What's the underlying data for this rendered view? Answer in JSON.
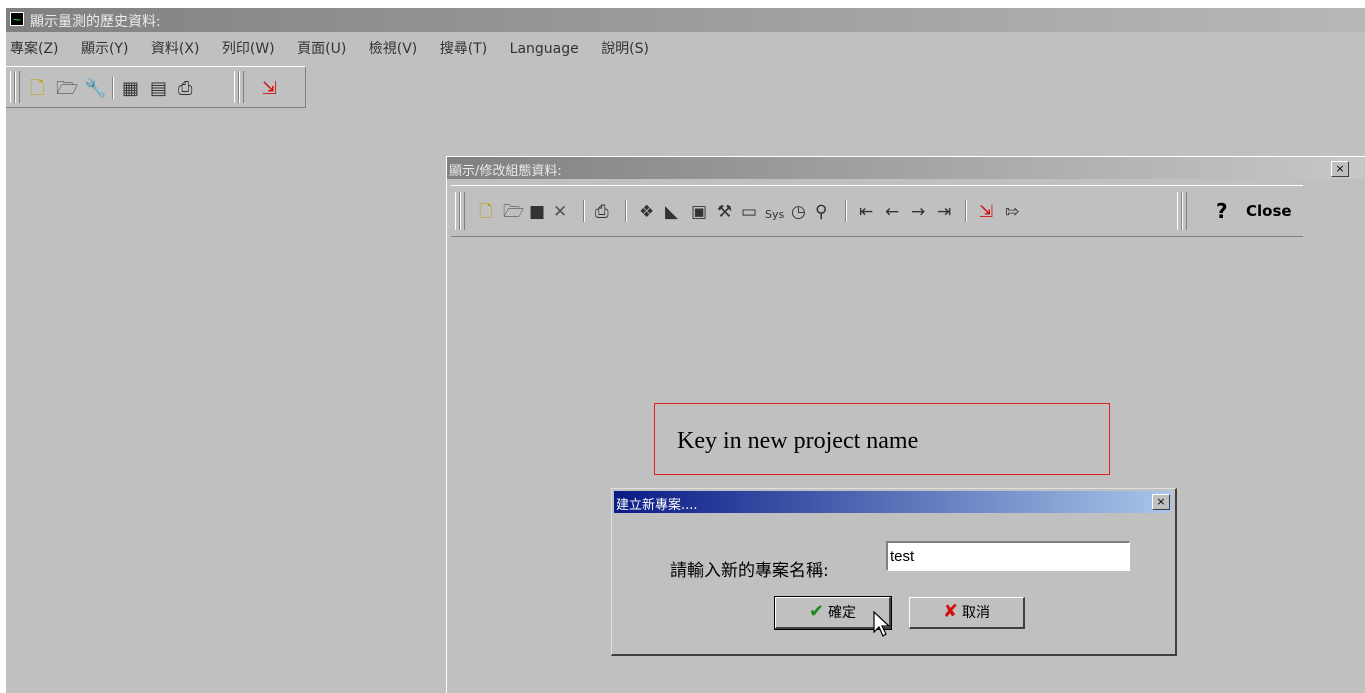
{
  "window": {
    "title": "顯示量測的歷史資料:"
  },
  "menu": [
    "專案(Z)",
    "顯示(Y)",
    "資料(X)",
    "列印(W)",
    "頁面(U)",
    "檢視(V)",
    "搜尋(T)",
    "Language",
    "說明(S)"
  ],
  "child_window": {
    "title": "顯示/修改組態資料:",
    "close_label": "Close",
    "close_glyph": "×",
    "help_glyph": "?"
  },
  "annotation": {
    "text": "Key in new project name"
  },
  "dialog": {
    "title": "建立新專案....",
    "prompt": "請輸入新的專案名稱:",
    "input_value": "test",
    "ok_label": "確定",
    "cancel_label": "取消"
  },
  "colors": {
    "dialog_title_start": "#0a1a86",
    "dialog_title_end": "#a9c6ea",
    "callout_border": "#e02020"
  }
}
